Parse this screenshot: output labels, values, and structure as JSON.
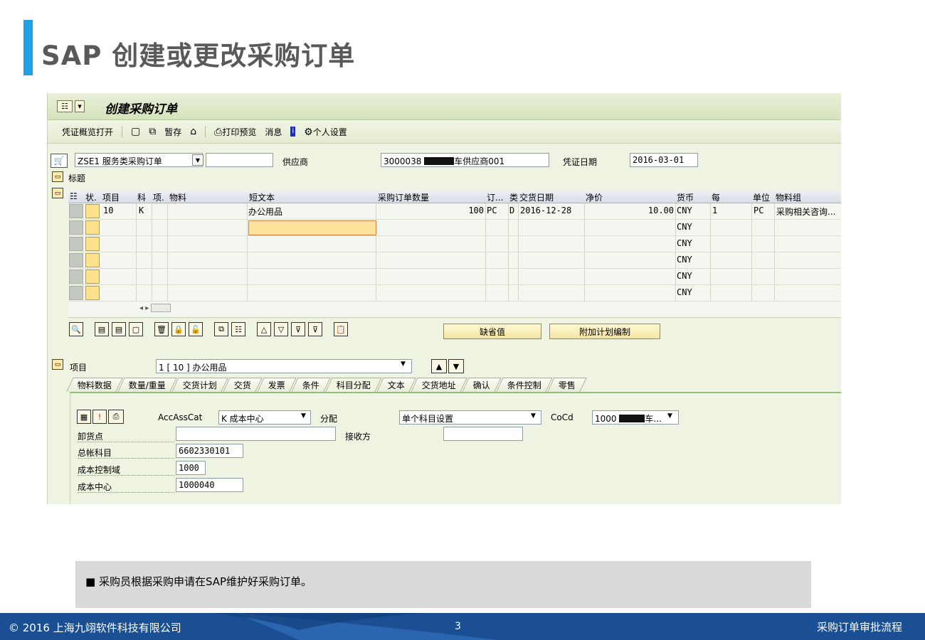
{
  "slide": {
    "title": "SAP 创建或更改采购订单",
    "note": "■  采购员根据采购申请在SAP维护好采购订单。",
    "footer_left": "© 2016 上海九翊软件科技有限公司",
    "page_number": "3",
    "footer_right": "采购订单审批流程"
  },
  "window": {
    "title": "创建采购订单",
    "toolbar": [
      "凭证概览打开",
      "暂存",
      "打印预览",
      "消息",
      "个人设置"
    ]
  },
  "doc": {
    "type_value": "ZSE1 服务类采购订单",
    "supplier_label": "供应商",
    "supplier_prefix": "3000038",
    "supplier_suffix": "车供应商001",
    "date_label": "凭证日期",
    "date_value": "2016-03-01",
    "header_label": "标题"
  },
  "grid": {
    "headers": [
      "状.",
      "项目",
      "科",
      "项.",
      "物料",
      "短文本",
      "采购订单数量",
      "订...",
      "类",
      "交货日期",
      "净价",
      "货币",
      "每",
      "单位",
      "物料组"
    ],
    "row1": {
      "item": "10",
      "acct": "K",
      "short_text": "办公用品",
      "qty": "100",
      "unit": "PC",
      "cat": "D",
      "delivery": "2016-12-28",
      "price": "10.00",
      "currency": "CNY",
      "per": "1",
      "order_unit": "PC",
      "mat_group": "采购相关咨询..."
    },
    "empty_currency": "CNY"
  },
  "buttons": {
    "defaults": "缺省值",
    "additional_planning": "附加计划编制"
  },
  "item": {
    "label": "项目",
    "select_value": "1 [ 10 ] 办公用品",
    "tabs": [
      "物料数据",
      "数量/重量",
      "交货计划",
      "交货",
      "发票",
      "条件",
      "科目分配",
      "文本",
      "交货地址",
      "确认",
      "条件控制",
      "零售"
    ],
    "active_tab": "科目分配"
  },
  "account": {
    "acc_label": "AccAssCat",
    "acc_value": "K 成本中心",
    "dist_label": "分配",
    "dist_value": "单个科目设置",
    "cocd_label": "CoCd",
    "cocd_prefix": "1000",
    "cocd_suffix": "车...",
    "unloading_label": "卸货点",
    "recipient_label": "接收方",
    "gl_label": "总帐科目",
    "gl_value": "6602330101",
    "co_area_label": "成本控制域",
    "co_area_value": "1000",
    "cost_center_label": "成本中心",
    "cost_center_value": "1000040"
  },
  "colors": {
    "accent": "#1fa1e2",
    "footer": "#1b4f94",
    "sap_bg": "#eef3e2"
  }
}
